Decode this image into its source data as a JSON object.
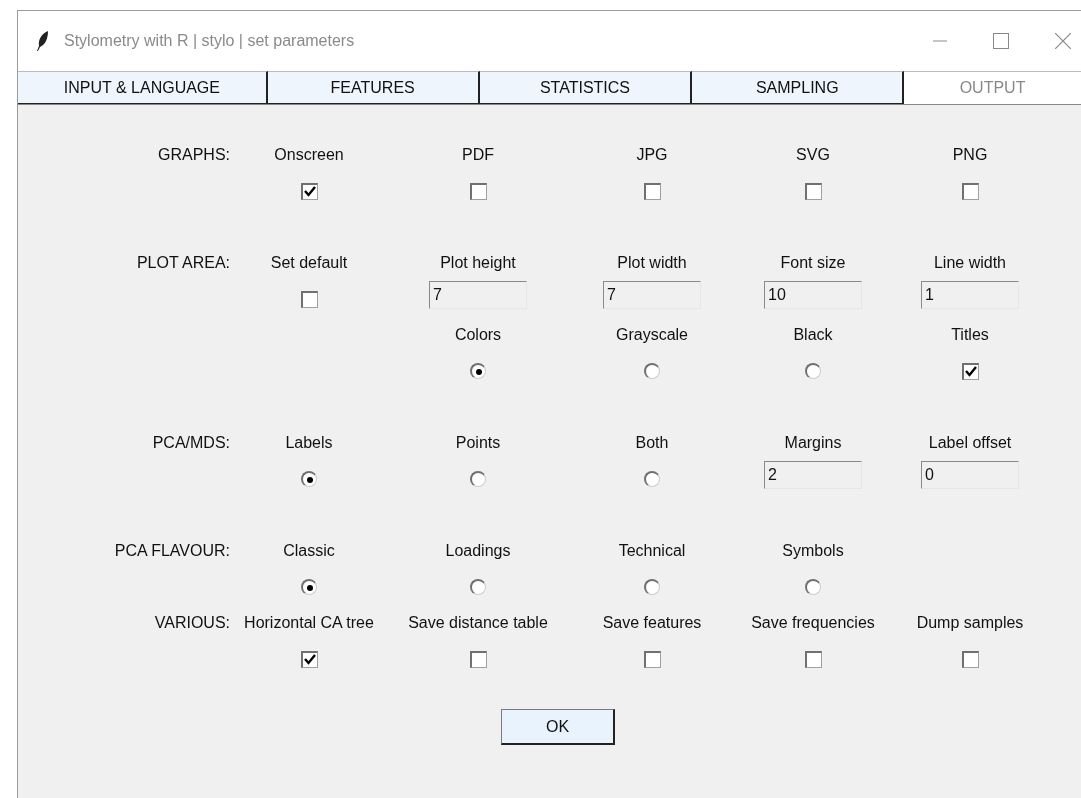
{
  "window": {
    "title": "Stylometry with R | stylo | set parameters"
  },
  "tabs": [
    {
      "label": "INPUT & LANGUAGE",
      "selected": false
    },
    {
      "label": "FEATURES",
      "selected": false
    },
    {
      "label": "STATISTICS",
      "selected": false
    },
    {
      "label": "SAMPLING",
      "selected": false
    },
    {
      "label": "OUTPUT",
      "selected": true
    }
  ],
  "sections": [
    {
      "label": "GRAPHS:",
      "rows": [
        [
          {
            "kind": "checkbox",
            "label": "Onscreen",
            "checked": true
          },
          {
            "kind": "checkbox",
            "label": "PDF",
            "checked": false
          },
          {
            "kind": "checkbox",
            "label": "JPG",
            "checked": false
          },
          {
            "kind": "checkbox",
            "label": "SVG",
            "checked": false
          },
          {
            "kind": "checkbox",
            "label": "PNG",
            "checked": false
          }
        ]
      ]
    },
    {
      "label": "PLOT AREA:",
      "rows": [
        [
          {
            "kind": "checkbox",
            "label": "Set default",
            "checked": false
          },
          {
            "kind": "field",
            "label": "Plot height",
            "value": "7"
          },
          {
            "kind": "field",
            "label": "Plot width",
            "value": "7"
          },
          {
            "kind": "field",
            "label": "Font size",
            "value": "10"
          },
          {
            "kind": "field",
            "label": "Line width",
            "value": "1"
          }
        ],
        [
          {
            "kind": "blank"
          },
          {
            "kind": "radio",
            "label": "Colors",
            "selected": true
          },
          {
            "kind": "radio",
            "label": "Grayscale",
            "selected": false
          },
          {
            "kind": "radio",
            "label": "Black",
            "selected": false
          },
          {
            "kind": "checkbox",
            "label": "Titles",
            "checked": true
          }
        ]
      ]
    },
    {
      "label": "PCA/MDS:",
      "rows": [
        [
          {
            "kind": "radio",
            "label": "Labels",
            "selected": true
          },
          {
            "kind": "radio",
            "label": "Points",
            "selected": false
          },
          {
            "kind": "radio",
            "label": "Both",
            "selected": false
          },
          {
            "kind": "field",
            "label": "Margins",
            "value": "2"
          },
          {
            "kind": "field",
            "label": "Label offset",
            "value": "0"
          }
        ]
      ]
    },
    {
      "label": "PCA FLAVOUR:",
      "rows": [
        [
          {
            "kind": "radio",
            "label": "Classic",
            "selected": true
          },
          {
            "kind": "radio",
            "label": "Loadings",
            "selected": false
          },
          {
            "kind": "radio",
            "label": "Technical",
            "selected": false
          },
          {
            "kind": "radio",
            "label": "Symbols",
            "selected": false
          }
        ]
      ]
    },
    {
      "label": "VARIOUS:",
      "rows": [
        [
          {
            "kind": "checkbox",
            "label": "Horizontal CA tree",
            "checked": true
          },
          {
            "kind": "checkbox",
            "label": "Save distance table",
            "checked": false
          },
          {
            "kind": "checkbox",
            "label": "Save features",
            "checked": false
          },
          {
            "kind": "checkbox",
            "label": "Save frequencies",
            "checked": false
          },
          {
            "kind": "checkbox",
            "label": "Dump samples",
            "checked": false
          }
        ]
      ]
    }
  ],
  "ok_button": "OK"
}
